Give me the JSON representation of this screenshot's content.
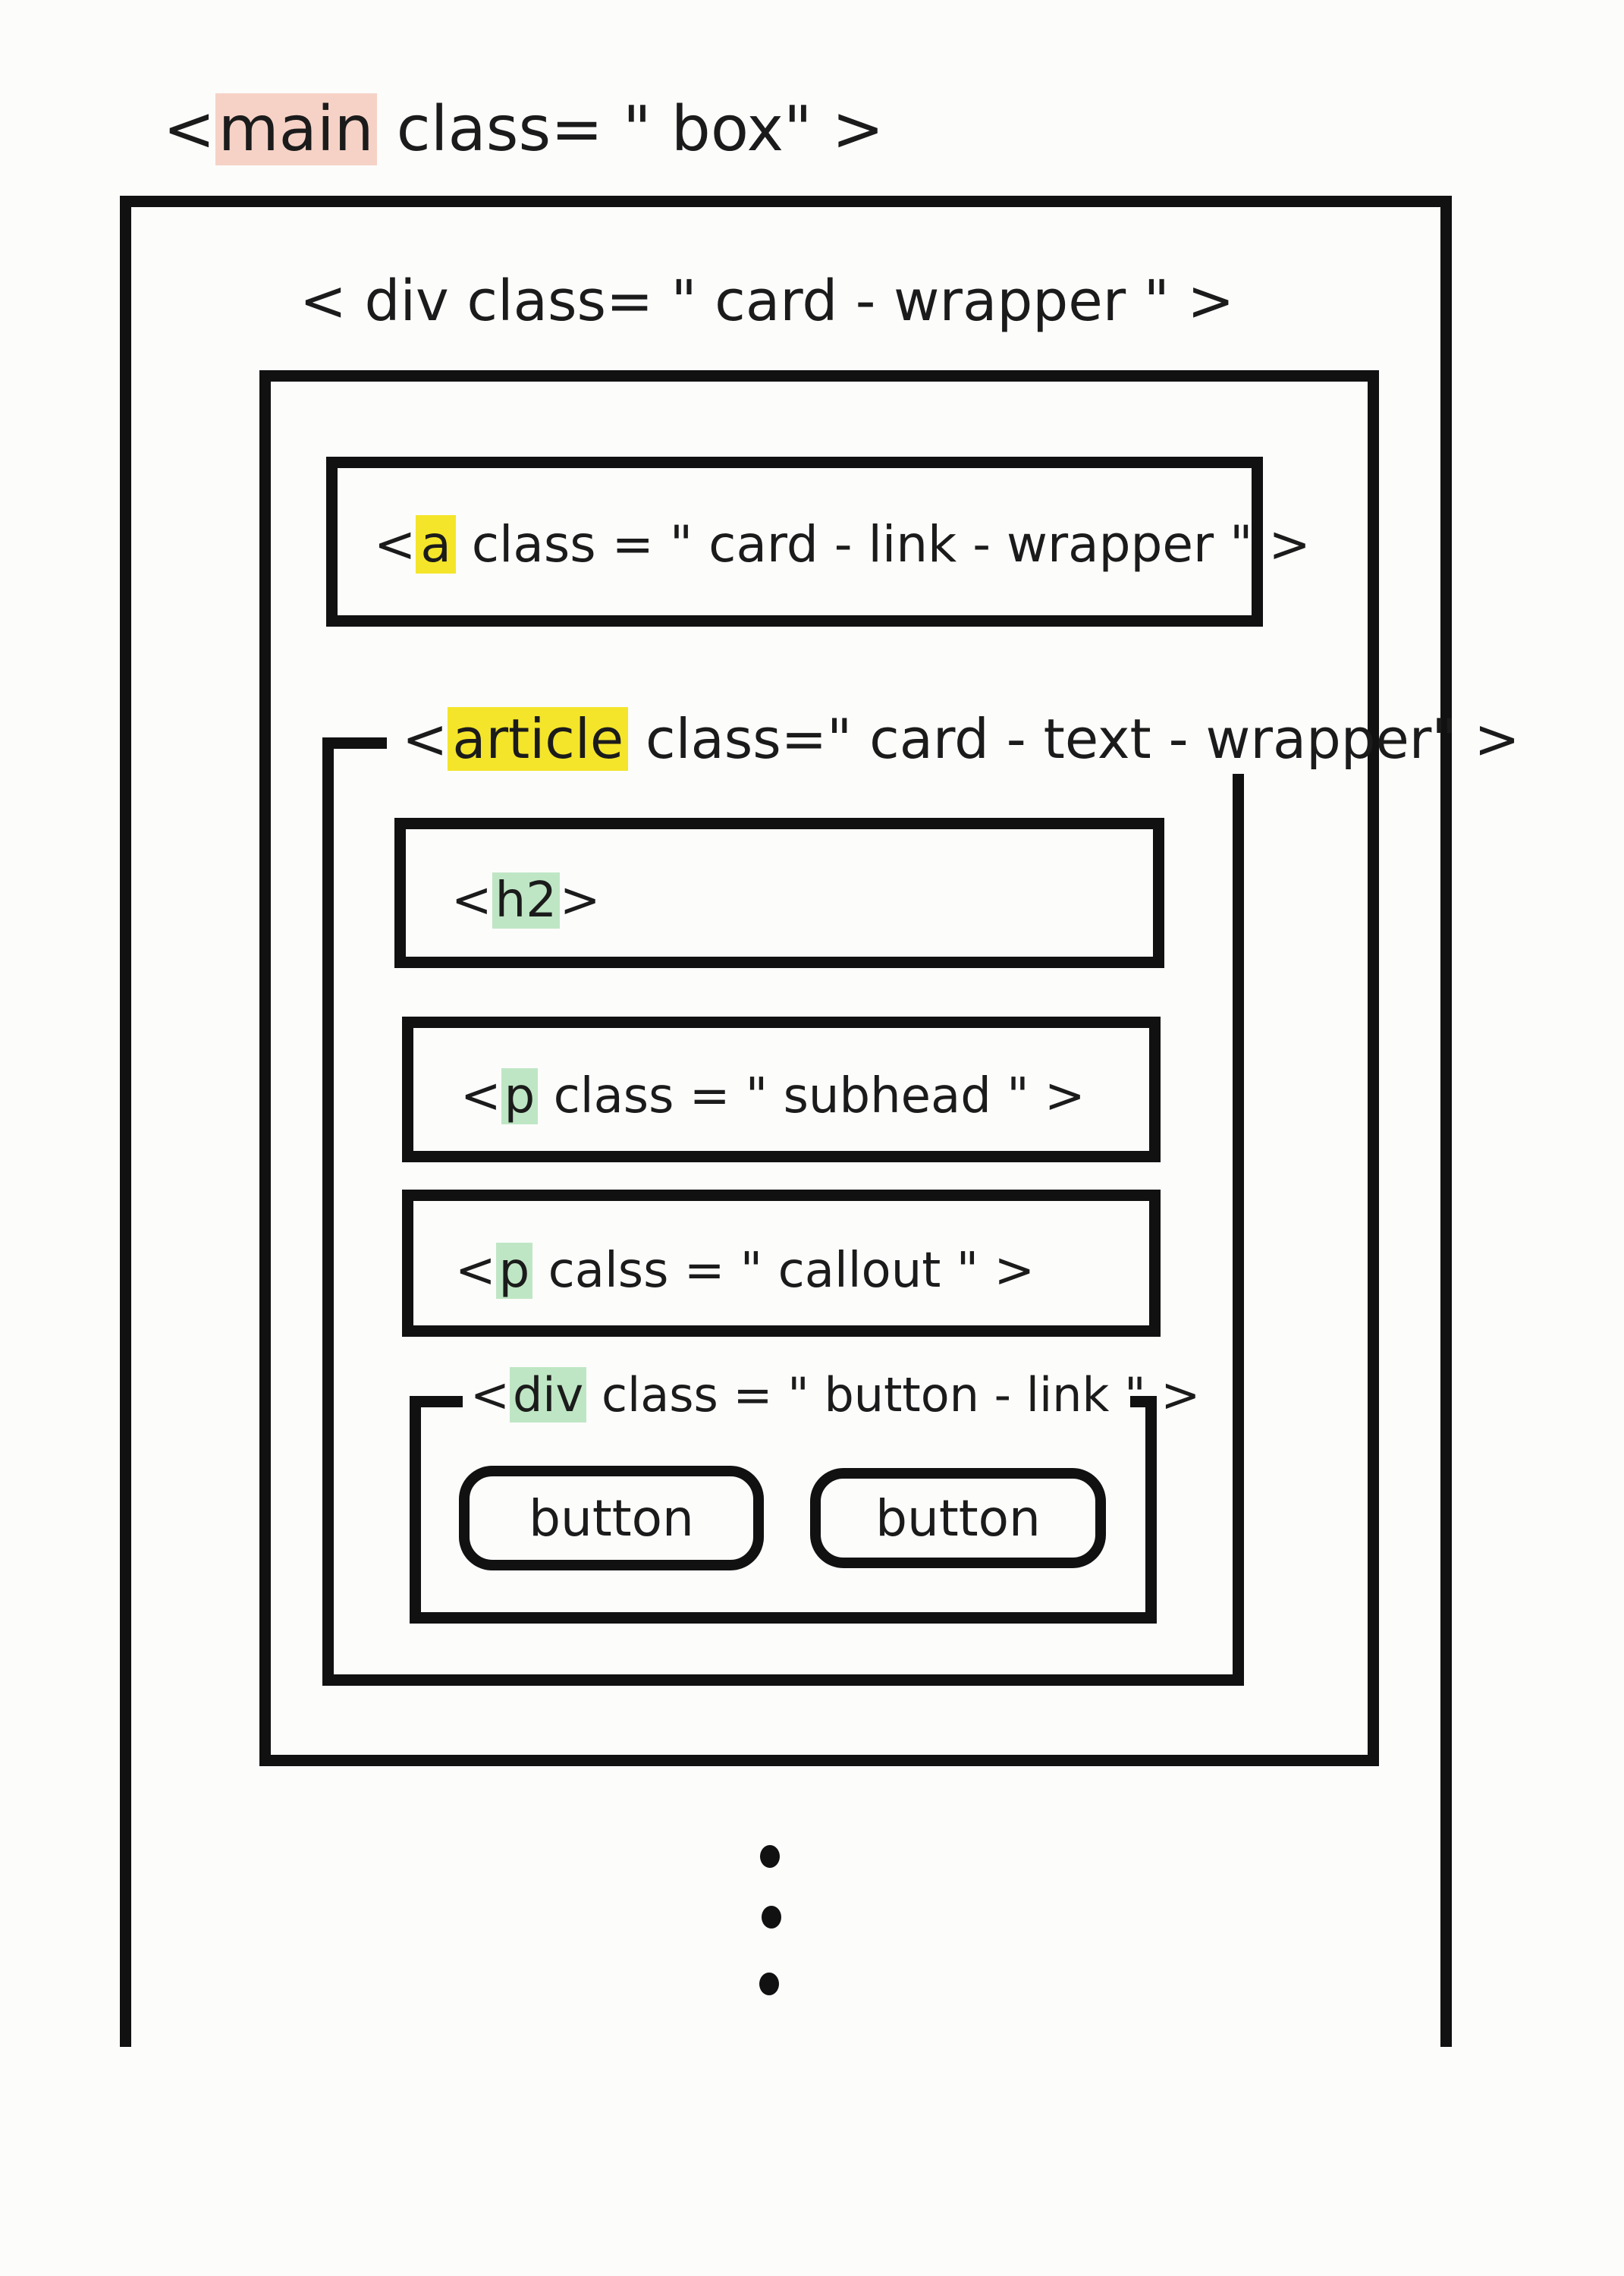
{
  "main": {
    "open": "<",
    "tag": "main",
    "attr": " class= \" box\" >"
  },
  "card_wrapper": {
    "label": "< div  class= \" card - wrapper \" >"
  },
  "link_wrapper": {
    "open": "<",
    "tag": "a",
    "attr": " class = \" card - link - wrapper \" >"
  },
  "text_wrapper": {
    "open": "<",
    "tag": "article",
    "attr": " class=\" card - text - wrapper\" >"
  },
  "heading": {
    "open": "<",
    "tag": "h2",
    "close": ">"
  },
  "subhead": {
    "open": "<",
    "tag": "p",
    "attr": " class = \" subhead \" >"
  },
  "callout": {
    "open": "<",
    "tag": "p",
    "attr": " calss = \" callout \" >"
  },
  "button_link": {
    "open": "<",
    "tag": "div",
    "attr": " class = \" button - link \" >"
  },
  "buttons": [
    {
      "label": "button"
    },
    {
      "label": "button"
    }
  ],
  "continuation": "more content (vertical ellipsis)",
  "colors": {
    "ink": "#111111",
    "highlight_yellow": "#f4e52a",
    "highlight_green": "#bfe6c4",
    "highlight_peach": "#f6d2c6"
  }
}
